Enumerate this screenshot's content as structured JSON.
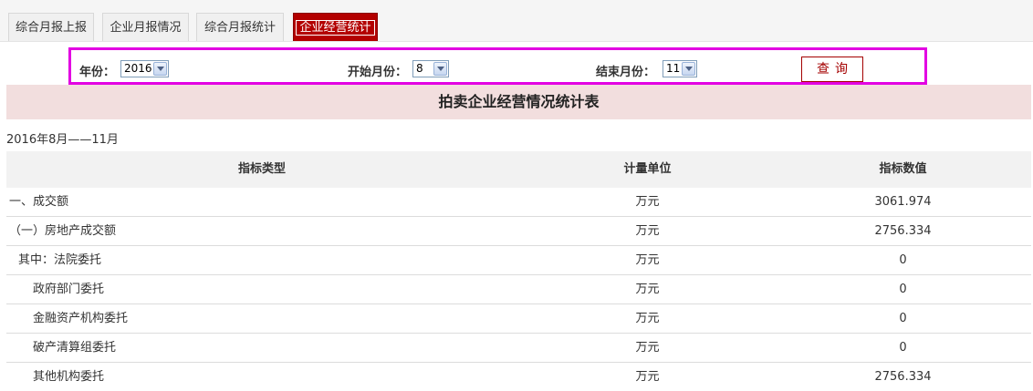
{
  "tabs": [
    {
      "label": "综合月报上报"
    },
    {
      "label": "企业月报情况"
    },
    {
      "label": "综合月报统计"
    },
    {
      "label": "企业经营统计"
    }
  ],
  "filters": {
    "year_label": "年份：",
    "year_value": "2016",
    "start_label": "开始月份：",
    "start_value": "8",
    "end_label": "结束月份：",
    "end_value": "11",
    "query_label": "查询"
  },
  "report": {
    "title": "拍卖企业经营情况统计表",
    "date_range": "2016年8月——11月"
  },
  "table": {
    "headers": [
      "指标类型",
      "计量单位",
      "指标数值"
    ],
    "rows": [
      {
        "name": "一、成交额",
        "unit": "万元",
        "value": "3061.974"
      },
      {
        "name": "（一）房地产成交额",
        "unit": "万元",
        "value": "2756.334"
      },
      {
        "name": "其中：法院委托",
        "unit": "万元",
        "value": "0"
      },
      {
        "name": "政府部门委托",
        "unit": "万元",
        "value": "0"
      },
      {
        "name": "金融资产机构委托",
        "unit": "万元",
        "value": "0"
      },
      {
        "name": "破产清算组委托",
        "unit": "万元",
        "value": "0"
      },
      {
        "name": "其他机构委托",
        "unit": "万元",
        "value": "2756.334"
      }
    ]
  },
  "colors": {
    "active_tab": "#b30000",
    "filter_border": "#e200e2",
    "title_bg": "#f2dede"
  }
}
